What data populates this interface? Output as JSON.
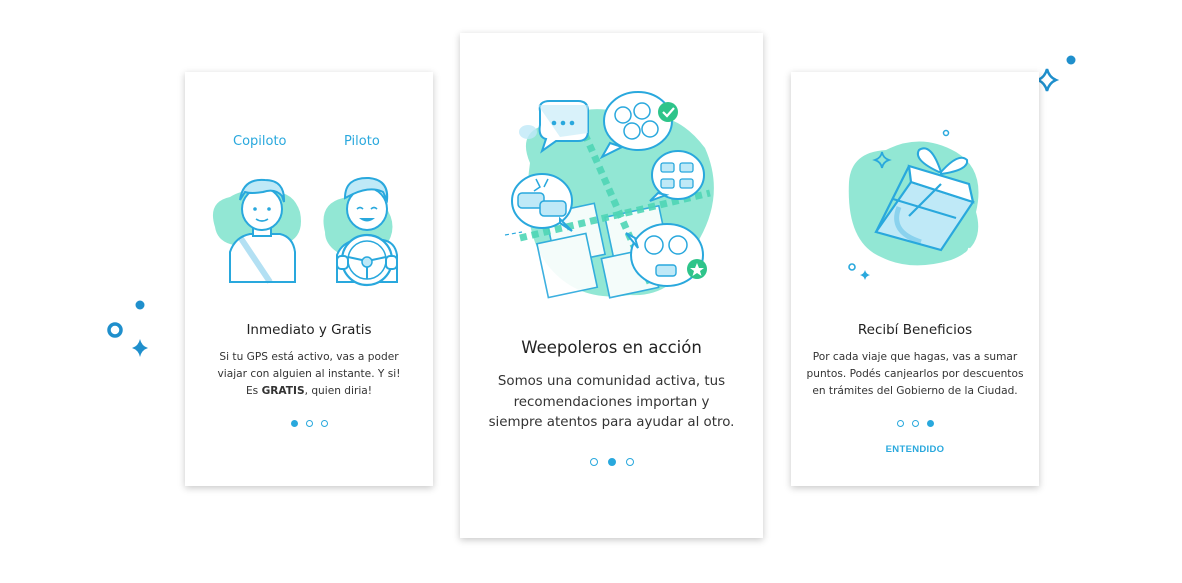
{
  "cards": [
    {
      "id": "card-1",
      "labels": {
        "left": "Copiloto",
        "right": "Piloto"
      },
      "title": "Inmediato y Gratis",
      "body_line1": "Si tu GPS está activo, vas a poder",
      "body_line2": "viajar con alguien al instante. Y si!",
      "body_line3_pre": "Es ",
      "body_line3_bold": "GRATIS",
      "body_line3_post": ", quien diria!",
      "active_dot": 1
    },
    {
      "id": "card-2",
      "title": "Weepoleros en acción",
      "body_line1": "Somos una comunidad activa, tus",
      "body_line2": "recomendaciones importan y",
      "body_line3": "siempre atentos para ayudar al otro.",
      "active_dot": 2
    },
    {
      "id": "card-3",
      "title": "Recibí Beneficios",
      "body_line1": "Por cada viaje que hagas, vas a sumar",
      "body_line2": "puntos. Podés canjearlos por descuentos",
      "body_line3": "en trámites del Gobierno de la Ciudad.",
      "cta_label": "ENTENDIDO",
      "active_dot": 3
    }
  ],
  "colors": {
    "accent": "#29a8dd",
    "mint": "#7fe3cc",
    "text": "#222222"
  },
  "icons": [
    "sparkle-icon",
    "circle-icon",
    "chat-bubble-icon",
    "check-badge-icon",
    "star-badge-icon",
    "car-icon",
    "gift-icon",
    "steering-wheel-icon"
  ]
}
